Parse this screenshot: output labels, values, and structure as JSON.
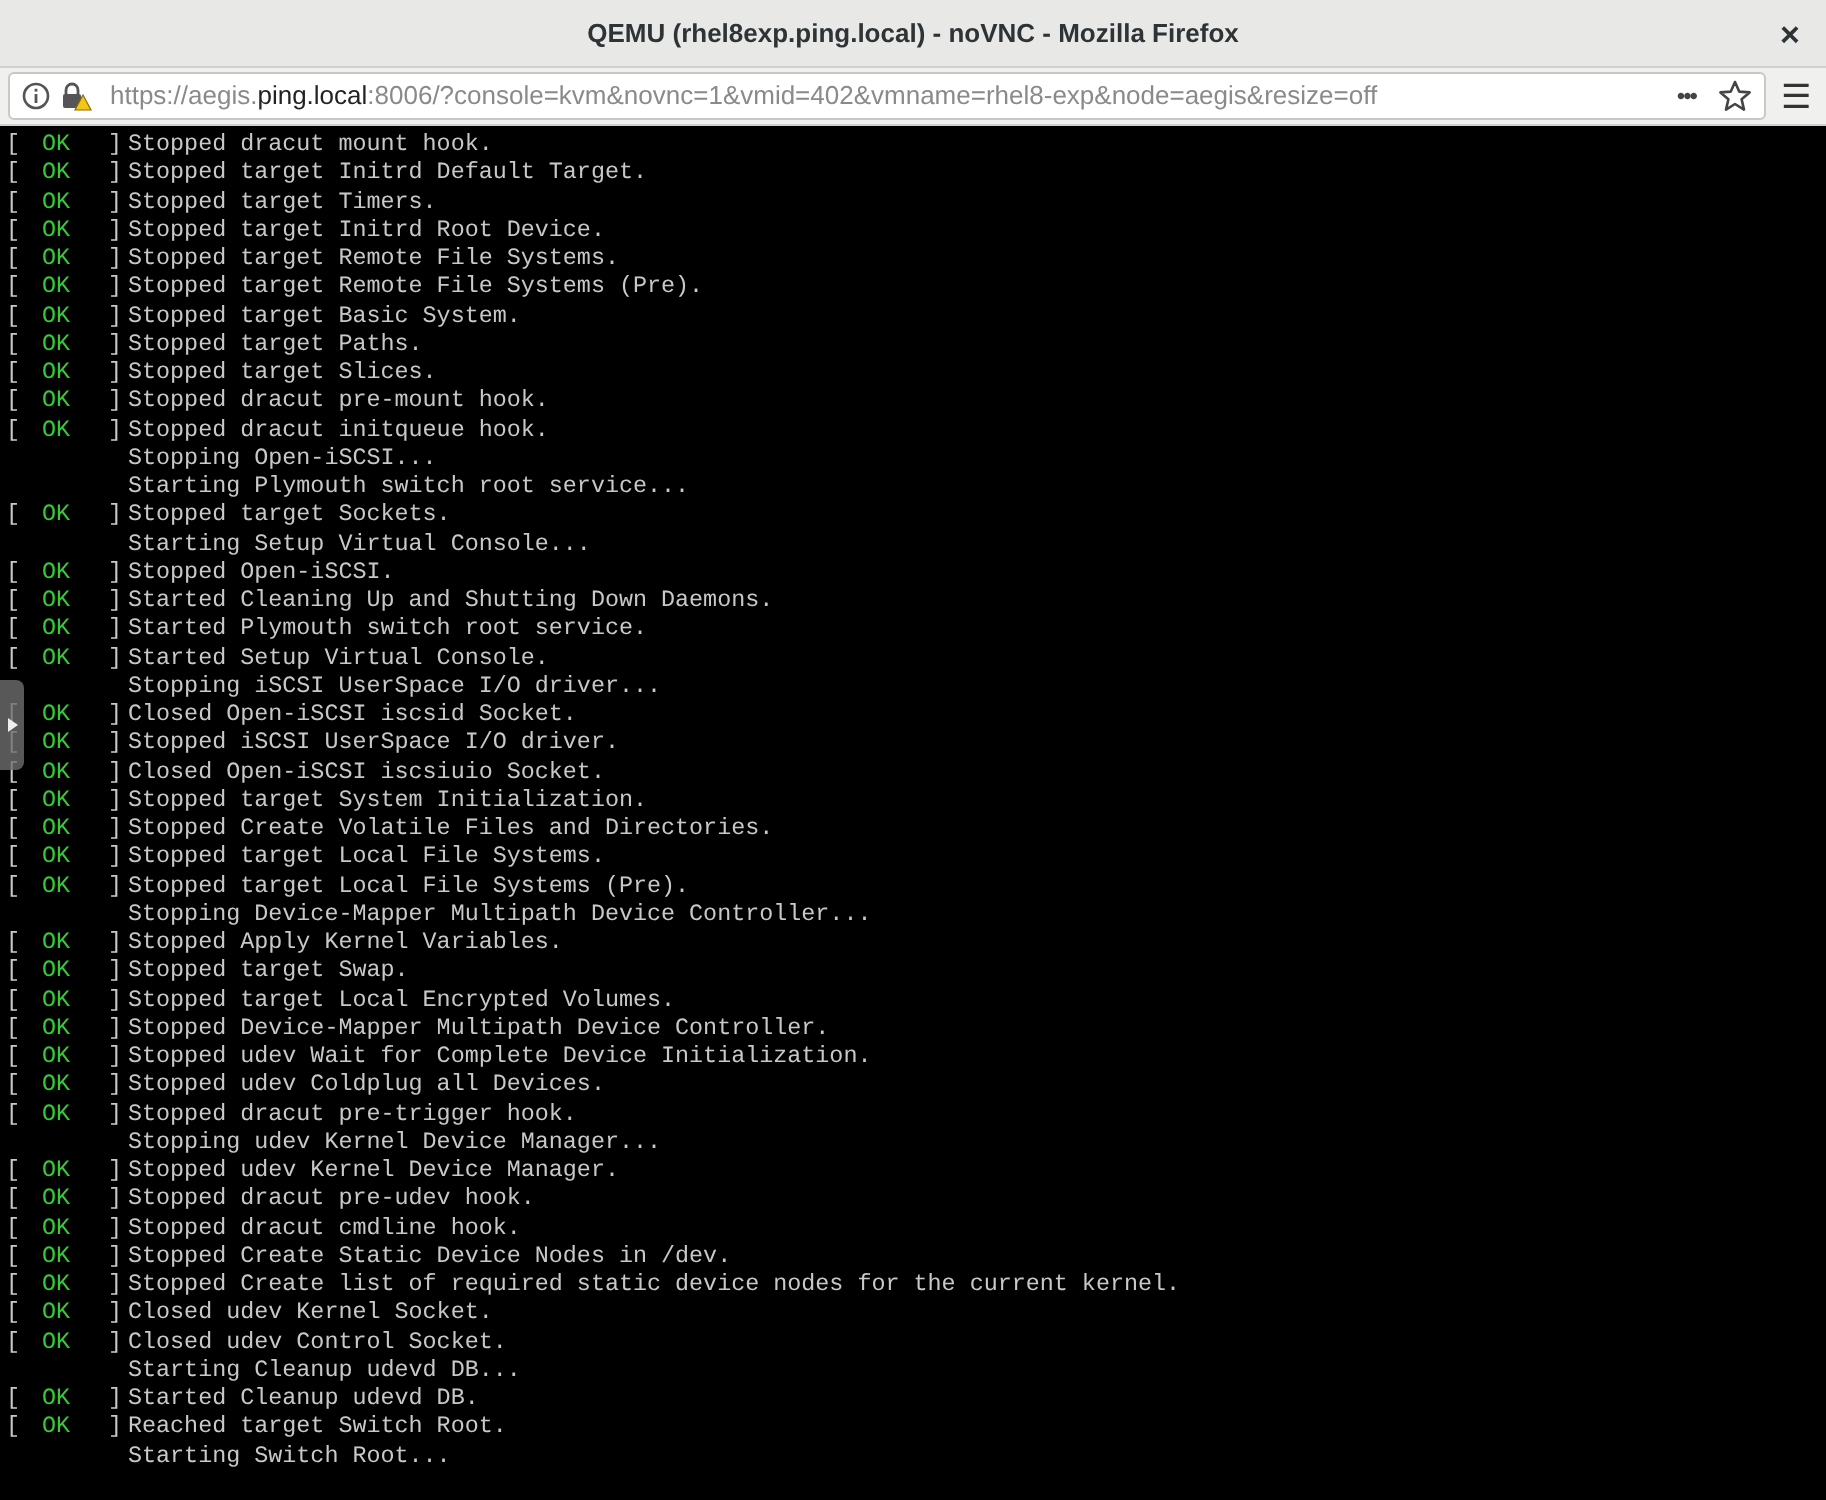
{
  "window": {
    "title": "QEMU (rhel8exp.ping.local) - noVNC - Mozilla Firefox",
    "close": "×"
  },
  "address_bar": {
    "url_prefix": "https://aegis.",
    "url_domain": "ping.local",
    "url_suffix": ":8006/?console=kvm&novnc=1&vmid=402&vmname=rhel8-exp&node=aegis&resize=off",
    "more": "•••",
    "menu": "☰"
  },
  "console": {
    "lines": [
      {
        "kind": "ok",
        "open": "[",
        "status": "OK",
        "close": "]",
        "text": "Stopped dracut mount hook."
      },
      {
        "kind": "ok",
        "open": "[",
        "status": "OK",
        "close": "]",
        "text": "Stopped target Initrd Default Target."
      },
      {
        "kind": "ok",
        "open": "[",
        "status": "OK",
        "close": "]",
        "text": "Stopped target Timers."
      },
      {
        "kind": "ok",
        "open": "[",
        "status": "OK",
        "close": "]",
        "text": "Stopped target Initrd Root Device."
      },
      {
        "kind": "ok",
        "open": "[",
        "status": "OK",
        "close": "]",
        "text": "Stopped target Remote File Systems."
      },
      {
        "kind": "ok",
        "open": "[",
        "status": "OK",
        "close": "]",
        "text": "Stopped target Remote File Systems (Pre)."
      },
      {
        "kind": "ok",
        "open": "[",
        "status": "OK",
        "close": "]",
        "text": "Stopped target Basic System."
      },
      {
        "kind": "ok",
        "open": "[",
        "status": "OK",
        "close": "]",
        "text": "Stopped target Paths."
      },
      {
        "kind": "ok",
        "open": "[",
        "status": "OK",
        "close": "]",
        "text": "Stopped target Slices."
      },
      {
        "kind": "ok",
        "open": "[",
        "status": "OK",
        "close": "]",
        "text": "Stopped dracut pre-mount hook."
      },
      {
        "kind": "ok",
        "open": "[",
        "status": "OK",
        "close": "]",
        "text": "Stopped dracut initqueue hook."
      },
      {
        "kind": "plain",
        "text": "Stopping Open-iSCSI..."
      },
      {
        "kind": "plain",
        "text": "Starting Plymouth switch root service..."
      },
      {
        "kind": "ok",
        "open": "[",
        "status": "OK",
        "close": "]",
        "text": "Stopped target Sockets."
      },
      {
        "kind": "plain",
        "text": "Starting Setup Virtual Console..."
      },
      {
        "kind": "ok",
        "open": "[",
        "status": "OK",
        "close": "]",
        "text": "Stopped Open-iSCSI."
      },
      {
        "kind": "ok",
        "open": "[",
        "status": "OK",
        "close": "]",
        "text": "Started Cleaning Up and Shutting Down Daemons."
      },
      {
        "kind": "ok",
        "open": "[",
        "status": "OK",
        "close": "]",
        "text": "Started Plymouth switch root service."
      },
      {
        "kind": "ok",
        "open": "[",
        "status": "OK",
        "close": "]",
        "text": "Started Setup Virtual Console."
      },
      {
        "kind": "plain",
        "text": "Stopping iSCSI UserSpace I/O driver..."
      },
      {
        "kind": "ok",
        "open": "[",
        "status": "OK",
        "close": "]",
        "text": "Closed Open-iSCSI iscsid Socket."
      },
      {
        "kind": "ok",
        "open": "[",
        "status": "OK",
        "close": "]",
        "text": "Stopped iSCSI UserSpace I/O driver."
      },
      {
        "kind": "ok",
        "open": "[",
        "status": "OK",
        "close": "]",
        "text": "Closed Open-iSCSI iscsiuio Socket."
      },
      {
        "kind": "ok",
        "open": "[",
        "status": "OK",
        "close": "]",
        "text": "Stopped target System Initialization."
      },
      {
        "kind": "ok",
        "open": "[",
        "status": "OK",
        "close": "]",
        "text": "Stopped Create Volatile Files and Directories."
      },
      {
        "kind": "ok",
        "open": "[",
        "status": "OK",
        "close": "]",
        "text": "Stopped target Local File Systems."
      },
      {
        "kind": "ok",
        "open": "[",
        "status": "OK",
        "close": "]",
        "text": "Stopped target Local File Systems (Pre)."
      },
      {
        "kind": "plain",
        "text": "Stopping Device-Mapper Multipath Device Controller..."
      },
      {
        "kind": "ok",
        "open": "[",
        "status": "OK",
        "close": "]",
        "text": "Stopped Apply Kernel Variables."
      },
      {
        "kind": "ok",
        "open": "[",
        "status": "OK",
        "close": "]",
        "text": "Stopped target Swap."
      },
      {
        "kind": "ok",
        "open": "[",
        "status": "OK",
        "close": "]",
        "text": "Stopped target Local Encrypted Volumes."
      },
      {
        "kind": "ok",
        "open": "[",
        "status": "OK",
        "close": "]",
        "text": "Stopped Device-Mapper Multipath Device Controller."
      },
      {
        "kind": "ok",
        "open": "[",
        "status": "OK",
        "close": "]",
        "text": "Stopped udev Wait for Complete Device Initialization."
      },
      {
        "kind": "ok",
        "open": "[",
        "status": "OK",
        "close": "]",
        "text": "Stopped udev Coldplug all Devices."
      },
      {
        "kind": "ok",
        "open": "[",
        "status": "OK",
        "close": "]",
        "text": "Stopped dracut pre-trigger hook."
      },
      {
        "kind": "plain",
        "text": "Stopping udev Kernel Device Manager..."
      },
      {
        "kind": "ok",
        "open": "[",
        "status": "OK",
        "close": "]",
        "text": "Stopped udev Kernel Device Manager."
      },
      {
        "kind": "ok",
        "open": "[",
        "status": "OK",
        "close": "]",
        "text": "Stopped dracut pre-udev hook."
      },
      {
        "kind": "ok",
        "open": "[",
        "status": "OK",
        "close": "]",
        "text": "Stopped dracut cmdline hook."
      },
      {
        "kind": "ok",
        "open": "[",
        "status": "OK",
        "close": "]",
        "text": "Stopped Create Static Device Nodes in /dev."
      },
      {
        "kind": "ok",
        "open": "[",
        "status": "OK",
        "close": "]",
        "text": "Stopped Create list of required static device nodes for the current kernel."
      },
      {
        "kind": "ok",
        "open": "[",
        "status": "OK",
        "close": "]",
        "text": "Closed udev Kernel Socket."
      },
      {
        "kind": "ok",
        "open": "[",
        "status": "OK",
        "close": "]",
        "text": "Closed udev Control Socket."
      },
      {
        "kind": "plain",
        "text": "Starting Cleanup udevd DB..."
      },
      {
        "kind": "ok",
        "open": "[",
        "status": "OK",
        "close": "]",
        "text": "Started Cleanup udevd DB."
      },
      {
        "kind": "ok",
        "open": "[",
        "status": "OK",
        "close": "]",
        "text": "Reached target Switch Root."
      },
      {
        "kind": "plain",
        "text": "Starting Switch Root..."
      }
    ]
  }
}
